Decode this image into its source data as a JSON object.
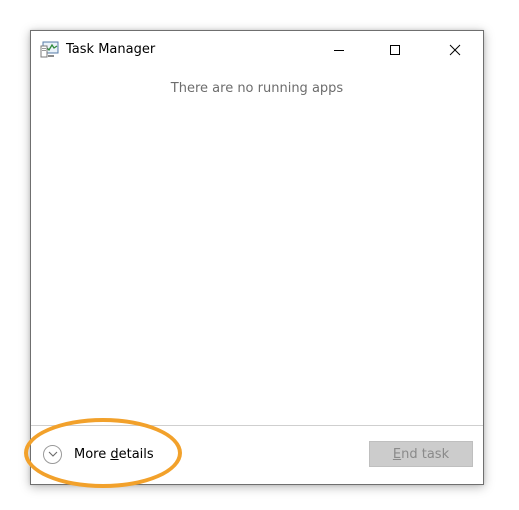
{
  "window": {
    "title": "Task Manager",
    "icon": "task-manager-icon",
    "controls": {
      "minimize": "minimize-icon",
      "maximize": "maximize-icon",
      "close": "close-icon"
    }
  },
  "content": {
    "empty_message": "There are no running apps"
  },
  "footer": {
    "more_details": {
      "label_prefix": "More ",
      "label_accel": "d",
      "label_suffix": "etails",
      "icon": "chevron-down-icon"
    },
    "end_task": {
      "label_accel": "E",
      "label_suffix": "nd task",
      "enabled": false
    }
  },
  "annotation": {
    "highlight_color": "#f2a12b"
  },
  "colors": {
    "button_disabled_bg": "#cccccc",
    "button_disabled_text": "#8a8a8a",
    "muted_text": "#6d6d6d"
  }
}
